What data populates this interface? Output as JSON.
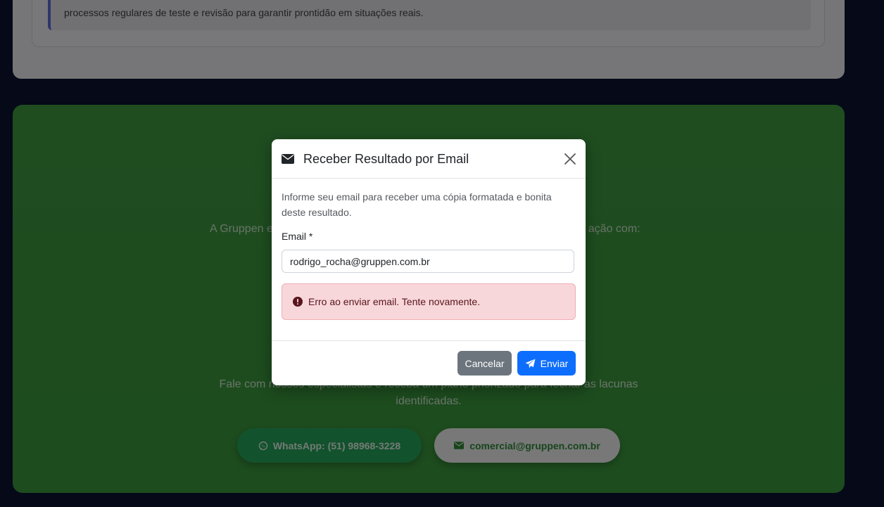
{
  "background": {
    "quote_text": "processos regulares de teste e revisão para garantir prontidão em situações reais.",
    "cta_text_left": "A Gruppen e",
    "cta_text_right": "m ação com:",
    "cta_bottom_text": "Fale com nossos especialistas e receba um plano priorizado para fechar as lacunas identificadas.",
    "whatsapp_label": "WhatsApp: (51) 98968-3228",
    "email_label": "comercial@gruppen.com.br"
  },
  "modal": {
    "title": "Receber Resultado por Email",
    "description": "Informe seu email para receber uma cópia formatada e bonita deste resultado.",
    "email_label": "Email *",
    "email_value": "rodrigo_rocha@gruppen.com.br",
    "error_message": "Erro ao enviar email. Tente novamente.",
    "cancel_label": "Cancelar",
    "send_label": "Enviar"
  },
  "colors": {
    "primary": "#0d6efd",
    "secondary": "#6c757d",
    "danger_bg": "#f8d7da",
    "danger_text": "#58151c",
    "green_panel": "#3f9a41"
  },
  "icons": [
    "envelope-icon",
    "close-icon",
    "exclamation-circle-icon",
    "paper-plane-icon",
    "whatsapp-icon"
  ]
}
